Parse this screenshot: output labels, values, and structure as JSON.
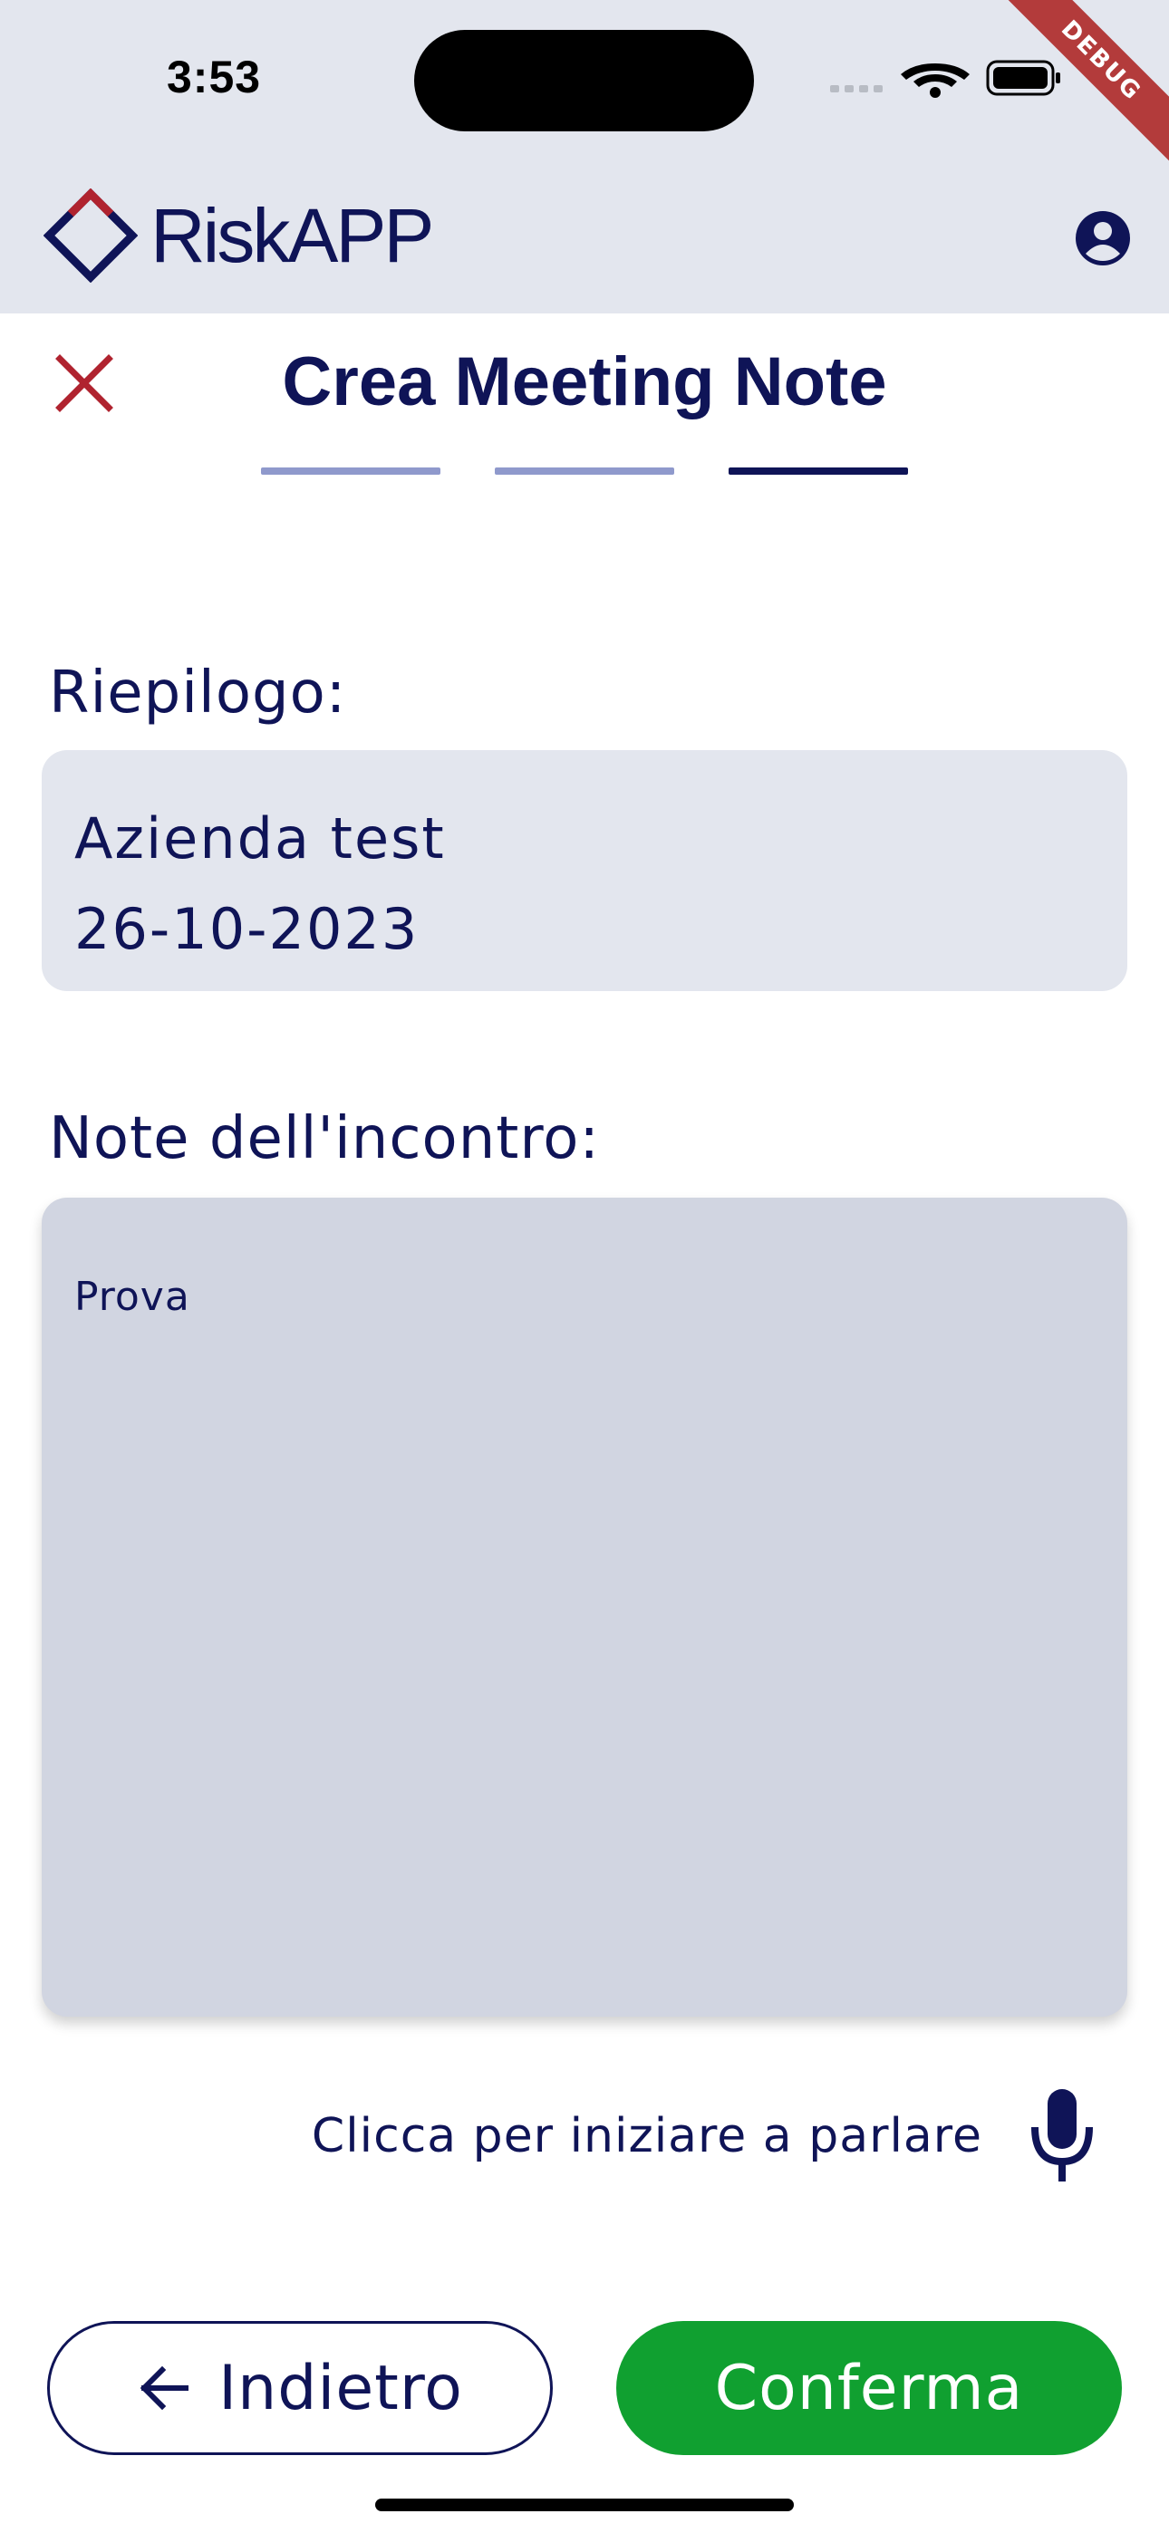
{
  "status_bar": {
    "time": "3:53",
    "debug_label": "DEBUG"
  },
  "header": {
    "app_name": "RiskAPP",
    "logo_icon": "diamond-logo-icon",
    "account_icon": "account-circle-icon"
  },
  "title": {
    "text": "Crea Meeting Note",
    "close_icon": "close-icon"
  },
  "stepper": {
    "total": 3,
    "current": 3
  },
  "summary": {
    "label": "Riepilogo:",
    "lines": [
      "Azienda test",
      "26-10-2023"
    ]
  },
  "notes": {
    "label": "Note dell'incontro:",
    "value": "Prova"
  },
  "speech": {
    "label": "Clicca per iniziare a parlare",
    "icon": "microphone-icon"
  },
  "actions": {
    "back_label": "Indietro",
    "back_icon": "arrow-left-icon",
    "confirm_label": "Conferma"
  },
  "colors": {
    "primary": "#0f1457",
    "header_bg": "#e3e6ee",
    "notes_bg": "#d1d5e1",
    "confirm": "#10a030",
    "close": "#b0232f",
    "step_done": "#8f99cc"
  }
}
